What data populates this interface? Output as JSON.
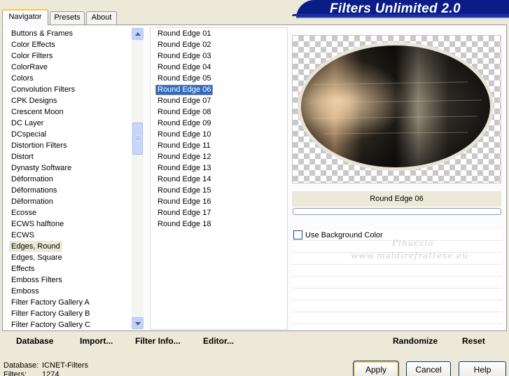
{
  "window": {
    "title": "Filters Unlimited 2.0"
  },
  "tabs": [
    {
      "label": "Navigator",
      "active": true
    },
    {
      "label": "Presets",
      "active": false
    },
    {
      "label": "About",
      "active": false
    }
  ],
  "categories": {
    "items": [
      "Buttons & Frames",
      "Color Effects",
      "Color Filters",
      "ColorRave",
      "Colors",
      "Convolution Filters",
      "CPK Designs",
      "Crescent Moon",
      "DC Layer",
      "DCspecial",
      "Distortion Filters",
      "Distort",
      "Dynasty Software",
      "Déformation",
      "Déformations",
      "Déformation",
      "Ecosse",
      "ECWS halftone",
      "ECWS",
      "Edges, Round",
      "Edges, Square",
      "Effects",
      "Emboss Filters",
      "Emboss",
      "Filter Factory Gallery A",
      "Filter Factory Gallery B",
      "Filter Factory Gallery C"
    ],
    "selected": "Edges, Round"
  },
  "filters": {
    "items": [
      "Round Edge 01",
      "Round Edge 02",
      "Round Edge 03",
      "Round Edge 04",
      "Round Edge 05",
      "Round Edge 06",
      "Round Edge 07",
      "Round Edge 08",
      "Round Edge 09",
      "Round Edge 10",
      "Round Edge 11",
      "Round Edge 12",
      "Round Edge 13",
      "Round Edge 14",
      "Round Edge 15",
      "Round Edge 16",
      "Round Edge 17",
      "Round Edge 18"
    ],
    "selected": "Round Edge 06"
  },
  "preview": {
    "filter_name": "Round Edge 06"
  },
  "parameters": {
    "use_background_color_label": "Use Background Color",
    "use_background_color_checked": false
  },
  "watermark": {
    "line1": "Pinuccia",
    "line2": "www.maldirefrattese.eu"
  },
  "toolbar": {
    "database_label": "Database",
    "import_label": "Import...",
    "filter_info_label": "Filter Info...",
    "editor_label": "Editor...",
    "randomize_label": "Randomize",
    "reset_label": "Reset"
  },
  "status": {
    "database_label": "Database:",
    "database_value": "ICNET-Filters",
    "filters_label": "Filters:",
    "filters_value": "1274"
  },
  "dialog_buttons": {
    "apply": "Apply",
    "cancel": "Cancel",
    "help": "Help"
  },
  "colors": {
    "banner": "#0a1c86",
    "selection": "#316ac5",
    "face": "#ece9d8"
  }
}
